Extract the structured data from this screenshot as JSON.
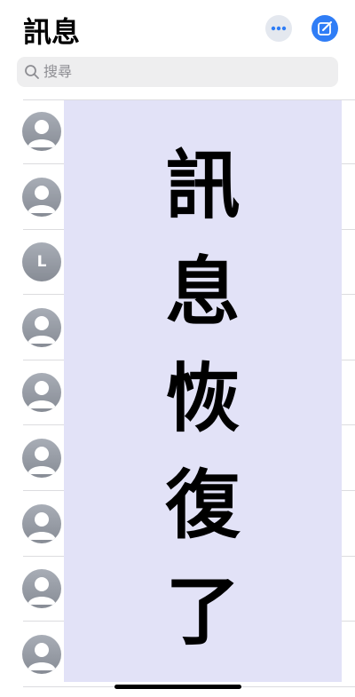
{
  "header": {
    "title": "訊息",
    "more_icon": "ellipsis-icon",
    "compose_icon": "compose-icon",
    "accent_color": "#2f7df6"
  },
  "search": {
    "placeholder": "搜尋",
    "icon": "magnifier-icon"
  },
  "conversations": [
    {
      "avatar": "person-silhouette",
      "initial": ""
    },
    {
      "avatar": "person-silhouette",
      "initial": ""
    },
    {
      "avatar": "initial",
      "initial": "L"
    },
    {
      "avatar": "person-silhouette",
      "initial": ""
    },
    {
      "avatar": "person-silhouette",
      "initial": ""
    },
    {
      "avatar": "person-silhouette",
      "initial": ""
    },
    {
      "avatar": "person-silhouette",
      "initial": ""
    },
    {
      "avatar": "person-silhouette",
      "initial": ""
    },
    {
      "avatar": "person-silhouette",
      "initial": ""
    }
  ],
  "overlay": {
    "characters": [
      "訊",
      "息",
      "恢",
      "復",
      "了"
    ],
    "background": "#e2e2f7"
  }
}
